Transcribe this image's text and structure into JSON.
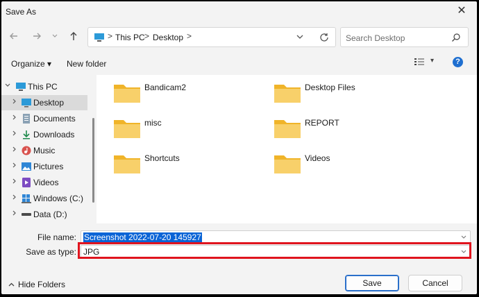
{
  "window": {
    "title": "Save As",
    "close_icon": "close-icon"
  },
  "navigation": {
    "back_icon": "arrow-left-icon",
    "forward_icon": "arrow-right-icon",
    "recent_icon": "chevron-down-icon",
    "up_icon": "arrow-up-icon"
  },
  "address": {
    "crumbs": [
      "This PC",
      "Desktop"
    ],
    "separator": ">",
    "dropdown_icon": "chevron-down-icon",
    "refresh_icon": "refresh-icon"
  },
  "search": {
    "placeholder": "Search Desktop",
    "icon": "search-icon"
  },
  "toolbar": {
    "organize_label": "Organize",
    "organize_arrow": "▾",
    "new_folder_label": "New folder",
    "view_icon": "view-options-icon",
    "view_arrow": "▾",
    "help_label": "?"
  },
  "sidebar": {
    "items": [
      {
        "label": "This PC",
        "icon": "computer-icon",
        "expanded": true
      },
      {
        "label": "Desktop",
        "icon": "desktop-icon",
        "selected": true
      },
      {
        "label": "Documents",
        "icon": "documents-icon"
      },
      {
        "label": "Downloads",
        "icon": "downloads-icon"
      },
      {
        "label": "Music",
        "icon": "music-icon"
      },
      {
        "label": "Pictures",
        "icon": "pictures-icon"
      },
      {
        "label": "Videos",
        "icon": "videos-icon"
      },
      {
        "label": "Windows (C:)",
        "icon": "drive-icon"
      },
      {
        "label": "Data (D:)",
        "icon": "drive-icon"
      }
    ],
    "chevron_right": ">",
    "chevron_down": "v"
  },
  "folders": [
    {
      "name": "Bandicam2"
    },
    {
      "name": "Desktop Files"
    },
    {
      "name": "misc"
    },
    {
      "name": "REPORT"
    },
    {
      "name": "Shortcuts"
    },
    {
      "name": "Videos"
    }
  ],
  "form": {
    "file_name_label": "File name:",
    "file_name_value": "Screenshot 2022-07-20 145927",
    "save_type_label": "Save as type:",
    "save_type_value": "JPG"
  },
  "footer": {
    "hide_folders_label": "Hide Folders",
    "hide_folders_chevron": "^",
    "save_label": "Save",
    "cancel_label": "Cancel"
  },
  "colors": {
    "folder": "#f5c342",
    "highlight_outline": "#e0141e",
    "selection": "#0a64d6",
    "accent": "#1f6fd0"
  }
}
